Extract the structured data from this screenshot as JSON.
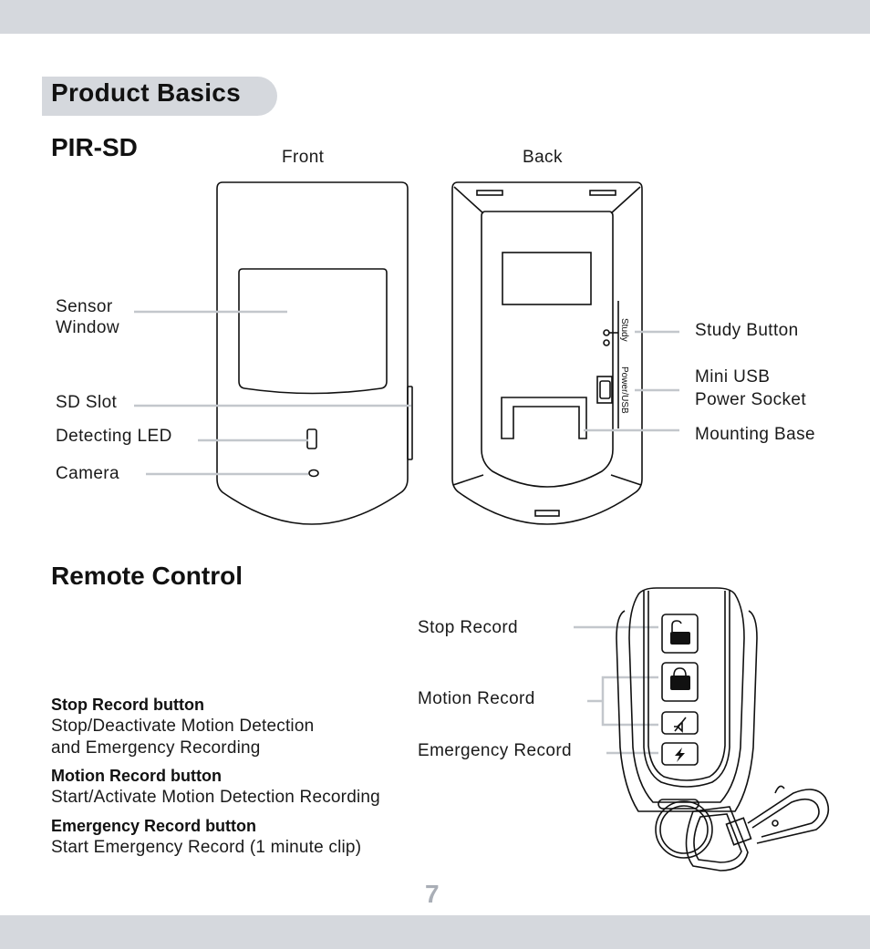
{
  "section": {
    "title": "Product Basics"
  },
  "pir": {
    "heading": "PIR-SD",
    "front_label": "Front",
    "back_label": "Back",
    "front_callouts": {
      "sensor_window": [
        "Sensor",
        "Window"
      ],
      "sd_slot": "SD Slot",
      "detecting_led": "Detecting LED",
      "camera": "Camera"
    },
    "back_callouts": {
      "study_button": "Study Button",
      "mini_usb": [
        "Mini USB",
        "Power Socket"
      ],
      "mounting_base": "Mounting Base"
    },
    "device_markings": {
      "study": "Study",
      "power_usb": "Power/USB"
    }
  },
  "remote": {
    "heading": "Remote Control",
    "callouts": {
      "stop_record": "Stop Record",
      "motion_record": "Motion Record",
      "emergency_record": "Emergency Record"
    },
    "buttons": [
      {
        "icon": "unlock-icon"
      },
      {
        "icon": "lock-icon"
      },
      {
        "icon": "mute-icon"
      },
      {
        "icon": "lightning-icon"
      }
    ],
    "descriptions": [
      {
        "title": "Stop Record button",
        "text": [
          "Stop/Deactivate Motion Detection",
          "and Emergency Recording"
        ]
      },
      {
        "title": "Motion Record button",
        "text": [
          "Start/Activate Motion Detection Recording"
        ]
      },
      {
        "title": "Emergency Record button",
        "text": [
          "Start Emergency Record (1 minute clip)"
        ]
      }
    ]
  },
  "page_number": "7",
  "colors": {
    "band": "#d5d8dd",
    "leader": "#c3c7cc",
    "page_number": "#a9aeb6"
  }
}
